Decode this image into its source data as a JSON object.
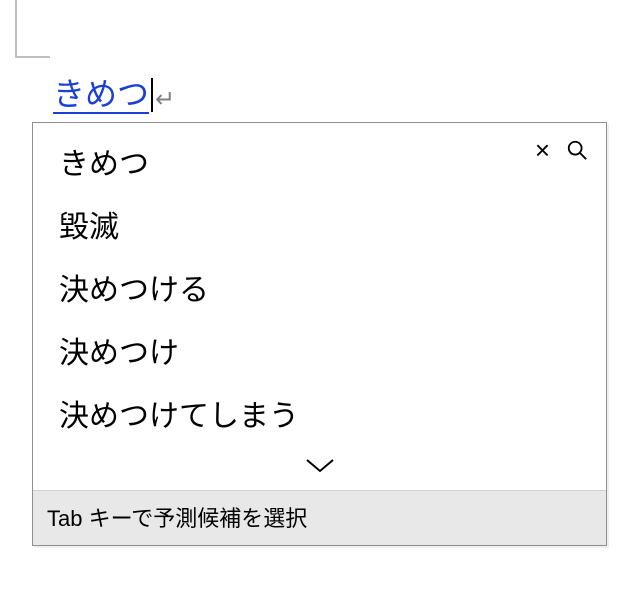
{
  "composition": {
    "text": "きめつ",
    "end_mark": "↵"
  },
  "candidates": [
    "きめつ",
    "毀滅",
    "決めつける",
    "決めつけ",
    "決めつけてしまう"
  ],
  "hint": "Tab キーで予測候補を選択",
  "icons": {
    "close": "close-icon",
    "search": "search-icon",
    "expand": "chevron-down-icon"
  }
}
